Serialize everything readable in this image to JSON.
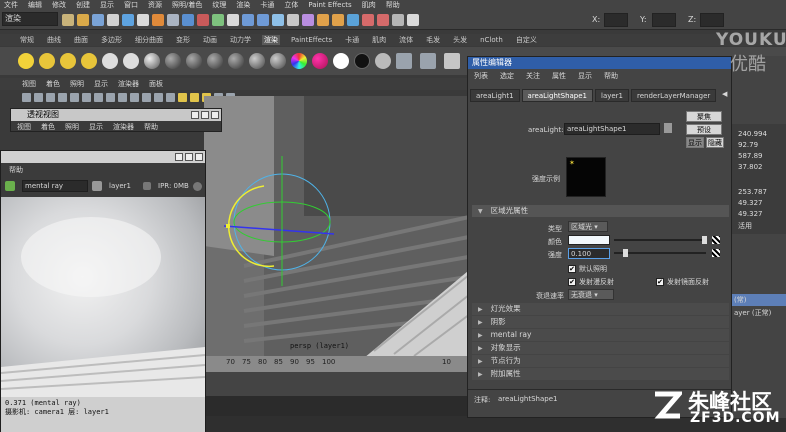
{
  "main_menu": [
    "文件",
    "编辑",
    "修改",
    "创建",
    "显示",
    "窗口",
    "资源",
    "照明/着色",
    "纹理",
    "渲染",
    "卡通",
    "立体",
    "Paint Effects",
    "肌肉",
    "帮助"
  ],
  "status_line": {
    "mode": "渲染",
    "x_label": "X:",
    "y_label": "Y:",
    "z_label": "Z:"
  },
  "shelf_tabs": [
    "常规",
    "曲线",
    "曲面",
    "多边形",
    "细分曲面",
    "变形",
    "动画",
    "动力学",
    "渲染",
    "PaintEffects",
    "卡通",
    "肌肉",
    "流体",
    "毛发",
    "头发",
    "nCloth",
    "自定义"
  ],
  "shelf_active": "渲染",
  "viewport_menu": [
    "视图",
    "着色",
    "照明",
    "显示",
    "渲染器",
    "面板"
  ],
  "hypershade_window": {
    "title": "透视视图",
    "menu": [
      "视图",
      "着色",
      "照明",
      "显示",
      "渲染器",
      "帮助"
    ]
  },
  "render_view": {
    "menu_label": "帮助",
    "renderer": "mental ray",
    "layer": "layer1",
    "ipr": "IPR: 0MB",
    "status_line1": "0.371            (mental ray)",
    "status_line2": "摄影机:  camera1        层:   layer1"
  },
  "viewport": {
    "hud": "persp (layer1)",
    "timeline_ticks": [
      "70",
      "75",
      "80",
      "85",
      "90",
      "95",
      "100",
      "10"
    ]
  },
  "attribute_editor": {
    "title": "属性编辑器",
    "menu": [
      "列表",
      "选定",
      "关注",
      "属性",
      "显示",
      "帮助"
    ],
    "tabs": [
      "areaLight1",
      "areaLightShape1",
      "layer1",
      "renderLayerManager"
    ],
    "active_tab": "areaLightShape1",
    "node_label": "areaLight:",
    "node_name": "areaLightShape1",
    "focus_btn": "聚焦",
    "preset_btn": "预设",
    "show_btn": "显示",
    "hide_btn": "隐藏",
    "swatch_label": "强度示例",
    "section_main": "区域光属性",
    "type_label": "类型",
    "type_value": "区域光",
    "color_label": "颜色",
    "color_value": "#f2f8fc",
    "intensity_label": "强度",
    "intensity_value": "0.100",
    "intensity_fraction": 0.1,
    "default_lighting": "默认照明",
    "emit_diffuse": "发射漫反射",
    "emit_specular": "发射镜面反射",
    "decay_label": "衰退速率",
    "decay_value": "无衰退",
    "sections": [
      "灯光效果",
      "阴影",
      "mental ray",
      "对象显示",
      "节点行为",
      "附加属性"
    ],
    "note_label": "注释:",
    "note_value": "areaLightShape1"
  },
  "channel_box": [
    "240.994",
    "92.79",
    "587.89",
    "37.802",
    "253.787",
    "49.327",
    "49.327",
    "活用"
  ],
  "channel_layer_items": [
    "(常)",
    "ayer (正常)"
  ],
  "watermarks": {
    "youku": "YOUKU",
    "youku_cn": "优酷",
    "zf": "朱峰社区",
    "zf3d": "ZF3D.COM"
  }
}
